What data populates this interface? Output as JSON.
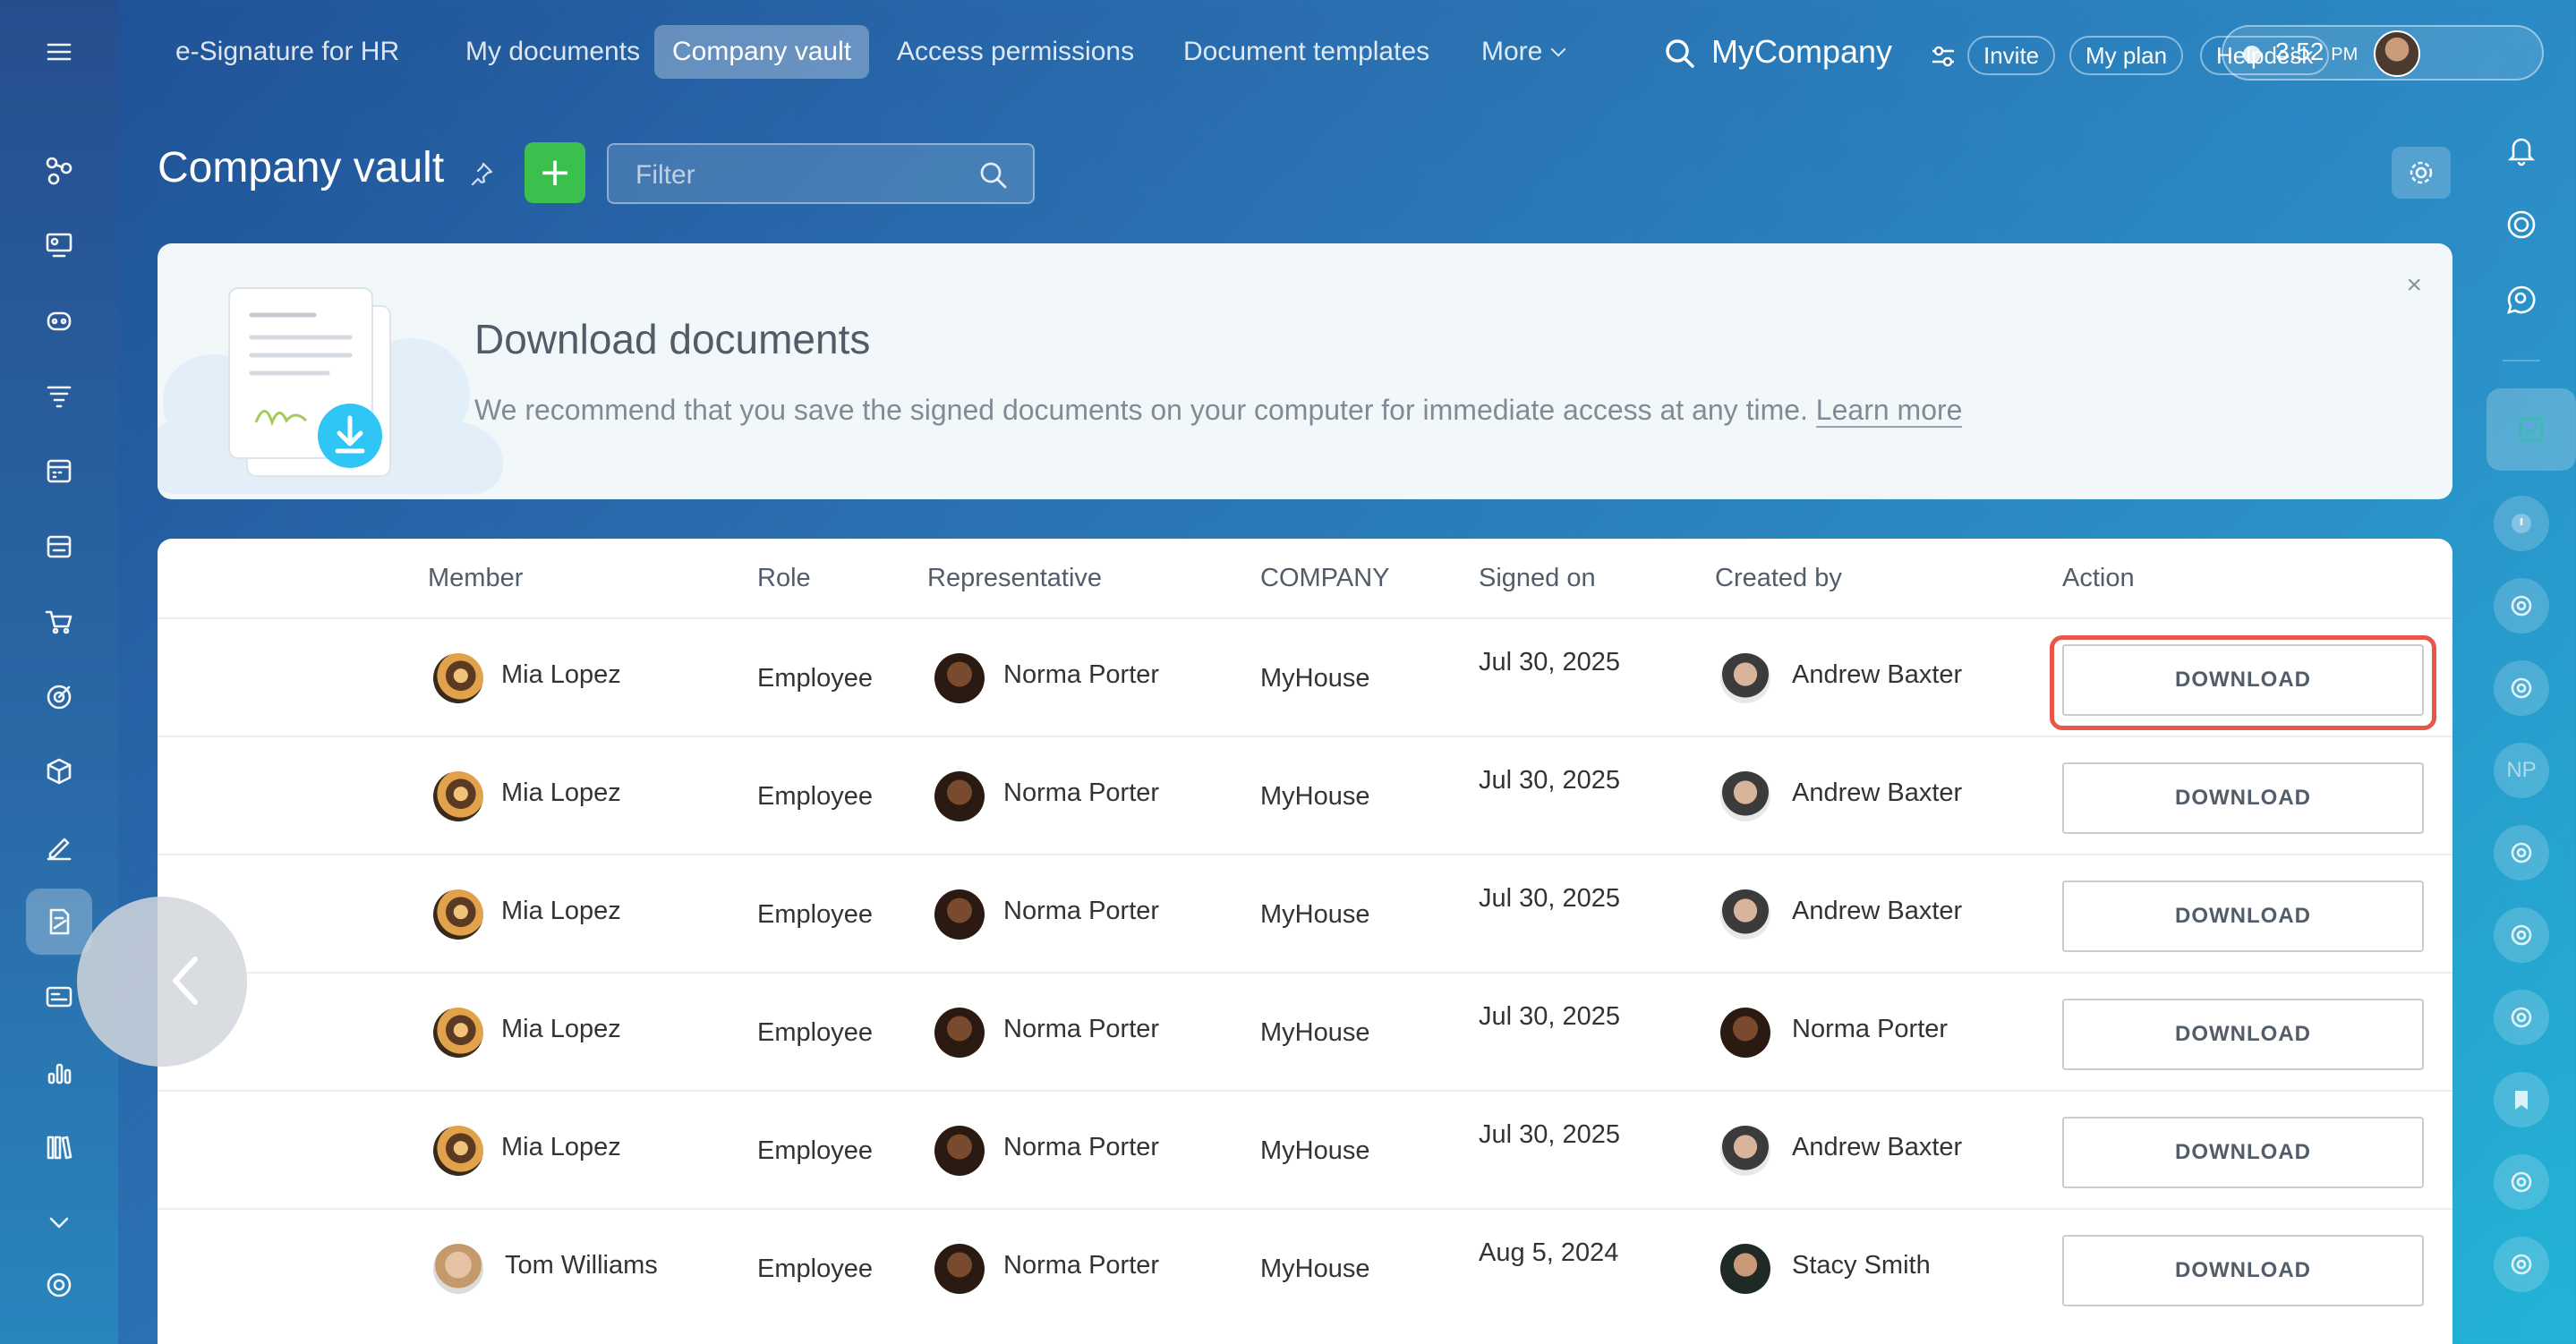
{
  "topnav": {
    "items": [
      "e-Signature for HR",
      "My documents",
      "Company vault",
      "Access permissions",
      "Document templates",
      "More"
    ],
    "active": "Company vault",
    "company": "MyCompany",
    "invite": "Invite",
    "my_plan": "My plan",
    "helpdesk": "Helpdesk",
    "time": "3:52",
    "ampm": "PM"
  },
  "header": {
    "title": "Company vault",
    "add_label": "+",
    "filter_placeholder": "Filter"
  },
  "banner": {
    "title": "Download documents",
    "text": "We recommend that you save the signed documents on your computer for immediate access at any time.",
    "link": "Learn more",
    "close": "×"
  },
  "table": {
    "columns": [
      "Member",
      "Role",
      "Representative",
      "COMPANY",
      "Signed on",
      "Created by",
      "Action"
    ],
    "rows": [
      {
        "member": "Mia Lopez",
        "role": "Employee",
        "rep": "Norma Porter",
        "company": "MyHouse",
        "signed": "Jul 30, 2025",
        "created": "Andrew Baxter",
        "action": "DOWNLOAD"
      },
      {
        "member": "Mia Lopez",
        "role": "Employee",
        "rep": "Norma Porter",
        "company": "MyHouse",
        "signed": "Jul 30, 2025",
        "created": "Andrew Baxter",
        "action": "DOWNLOAD"
      },
      {
        "member": "Mia Lopez",
        "role": "Employee",
        "rep": "Norma Porter",
        "company": "MyHouse",
        "signed": "Jul 30, 2025",
        "created": "Andrew Baxter",
        "action": "DOWNLOAD"
      },
      {
        "member": "Mia Lopez",
        "role": "Employee",
        "rep": "Norma Porter",
        "company": "MyHouse",
        "signed": "Jul 30, 2025",
        "created": "Norma Porter",
        "action": "DOWNLOAD"
      },
      {
        "member": "Mia Lopez",
        "role": "Employee",
        "rep": "Norma Porter",
        "company": "MyHouse",
        "signed": "Jul 30, 2025",
        "created": "Andrew Baxter",
        "action": "DOWNLOAD"
      },
      {
        "member": "Tom Williams",
        "role": "Employee",
        "rep": "Norma Porter",
        "company": "MyHouse",
        "signed": "Aug 5, 2024",
        "created": "Stacy Smith",
        "action": "DOWNLOAD"
      }
    ]
  },
  "right_bar": {
    "initials": "NP"
  },
  "colors": {
    "accent_green": "#3cc04d",
    "highlight_red": "#e8564a"
  }
}
